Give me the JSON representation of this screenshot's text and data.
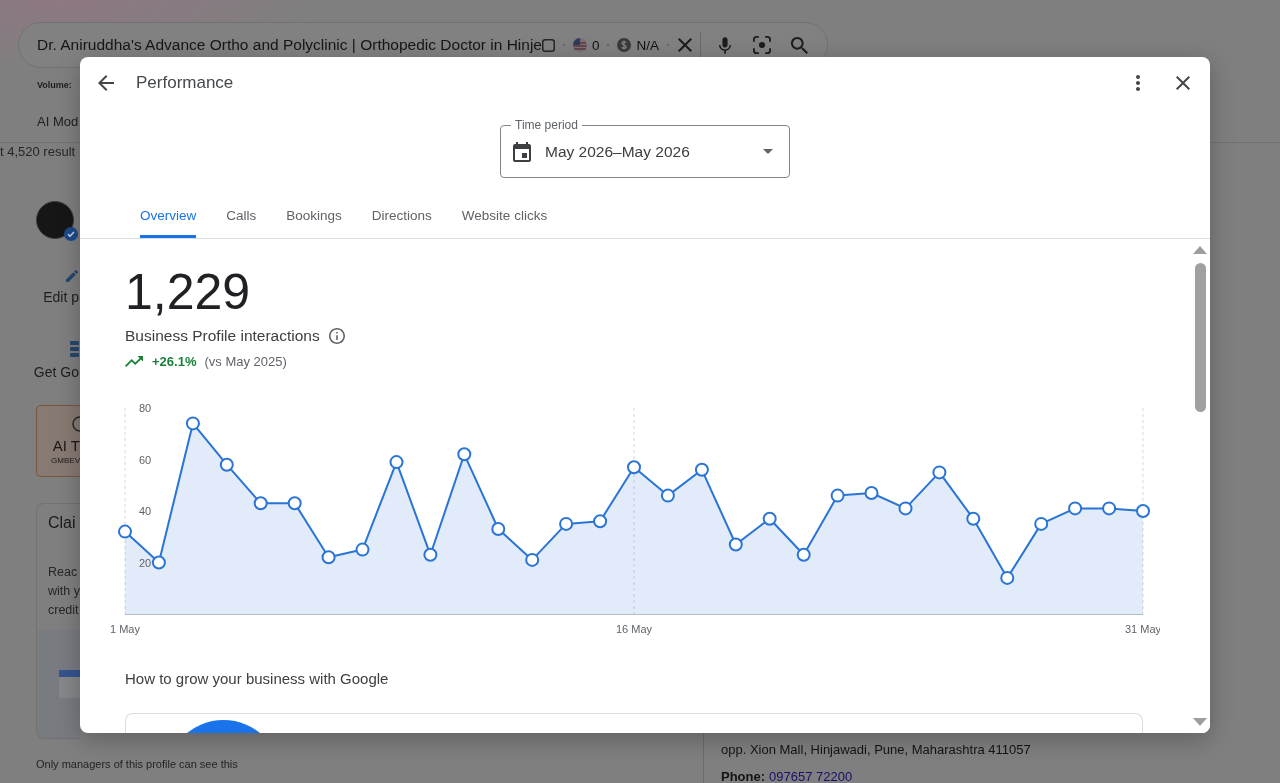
{
  "background_page": {
    "search": {
      "query": "Dr. Aniruddha's Advance Ortho and Polyclinic | Orthopedic Doctor in Hinje",
      "stats": [
        {
          "value": "0"
        },
        {
          "value": "N/A"
        }
      ]
    },
    "volume_label": "Volume:",
    "ai_mode_tab": "AI Mod",
    "results_count": "t 4,520 result",
    "profile_actions": [
      {
        "label": "Edit p"
      },
      {
        "label": "Get Go"
      }
    ],
    "ai_card": {
      "title": "AI T",
      "subtitle": "GMBEV"
    },
    "claim_card": {
      "title": "Clai",
      "lines": [
        "Reac",
        "with y",
        "credit"
      ]
    },
    "managers_note": "Only managers of this profile can see this",
    "address": "opp. Xion Mall, Hinjawadi, Pune, Maharashtra 411057",
    "phone": {
      "label": "Phone:",
      "number": "097657 72200"
    }
  },
  "dialog": {
    "title": "Performance",
    "time_period": {
      "label": "Time period",
      "value": "May 2026–May 2026"
    },
    "tabs": [
      {
        "label": "Overview",
        "selected": true
      },
      {
        "label": "Calls",
        "selected": false
      },
      {
        "label": "Bookings",
        "selected": false
      },
      {
        "label": "Directions",
        "selected": false
      },
      {
        "label": "Website clicks",
        "selected": false
      }
    ],
    "metric": {
      "value": "1,229",
      "label": "Business Profile interactions",
      "increase": true,
      "change": "+26.1%",
      "comparison": "(vs May 2025)"
    },
    "chart_data": {
      "type": "area",
      "categories": [
        "1 May",
        null,
        null,
        null,
        null,
        null,
        null,
        null,
        null,
        null,
        null,
        null,
        null,
        null,
        null,
        "16 May",
        null,
        null,
        null,
        null,
        null,
        null,
        null,
        null,
        null,
        null,
        null,
        null,
        null,
        null,
        "31 May"
      ],
      "series": [
        {
          "color": "#2a74d6",
          "values": [
            32,
            20,
            74,
            58,
            43,
            43,
            22,
            25,
            59,
            23,
            62,
            33,
            21,
            35,
            36,
            57,
            46,
            56,
            27,
            37,
            23,
            46,
            47,
            41,
            55,
            37,
            14,
            35,
            41,
            41,
            40
          ]
        }
      ],
      "ylim": [
        0,
        80
      ],
      "yticks": [
        20,
        40,
        60,
        80
      ]
    },
    "section_title": "How to grow your business with Google"
  }
}
